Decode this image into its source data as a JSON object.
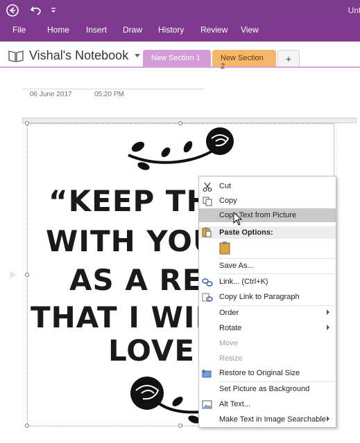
{
  "window": {
    "title": "Untitl"
  },
  "ribbon": {
    "tabs": [
      {
        "label": "File"
      },
      {
        "label": "Home"
      },
      {
        "label": "Insert"
      },
      {
        "label": "Draw"
      },
      {
        "label": "History"
      },
      {
        "label": "Review"
      },
      {
        "label": "View"
      }
    ]
  },
  "notebook": {
    "name": "Vishal's Notebook",
    "sections": [
      {
        "label": "New Section 1",
        "color": "#d29cd6",
        "active": true
      },
      {
        "label": "New Section 2",
        "color": "#f4b76a",
        "active": false
      }
    ],
    "add_label": "+"
  },
  "page": {
    "date": "06 June 2017",
    "time": "05:20 PM"
  },
  "image": {
    "lines": [
      "“KEEP THIS",
      "WITH YOU",
      "AS A REM",
      "THAT I WILL",
      "LOVE Y"
    ]
  },
  "context_menu": {
    "items": [
      {
        "label": "Cut",
        "icon": "scissors-icon"
      },
      {
        "label": "Copy",
        "icon": "copy-icon"
      },
      {
        "label": "Copy Text from Picture",
        "icon": "",
        "highlighted": true
      },
      {
        "label": "Paste Options:",
        "icon": "paste-icon"
      },
      {
        "label": "Save As...",
        "icon": ""
      },
      {
        "label": "Link...  (Ctrl+K)",
        "icon": "link-icon"
      },
      {
        "label": "Copy Link to Paragraph",
        "icon": "link-paragraph-icon"
      },
      {
        "label": "Order",
        "icon": "",
        "submenu": true
      },
      {
        "label": "Rotate",
        "icon": "",
        "submenu": true
      },
      {
        "label": "Move",
        "icon": "",
        "disabled": true
      },
      {
        "label": "Resize",
        "icon": "",
        "disabled": true
      },
      {
        "label": "Restore to Original Size",
        "icon": "restore-size-icon"
      },
      {
        "label": "Set Picture as Background",
        "icon": ""
      },
      {
        "label": "Alt Text...",
        "icon": "alt-text-icon"
      },
      {
        "label": "Make Text in Image Searchable",
        "icon": "",
        "submenu": true
      }
    ]
  }
}
